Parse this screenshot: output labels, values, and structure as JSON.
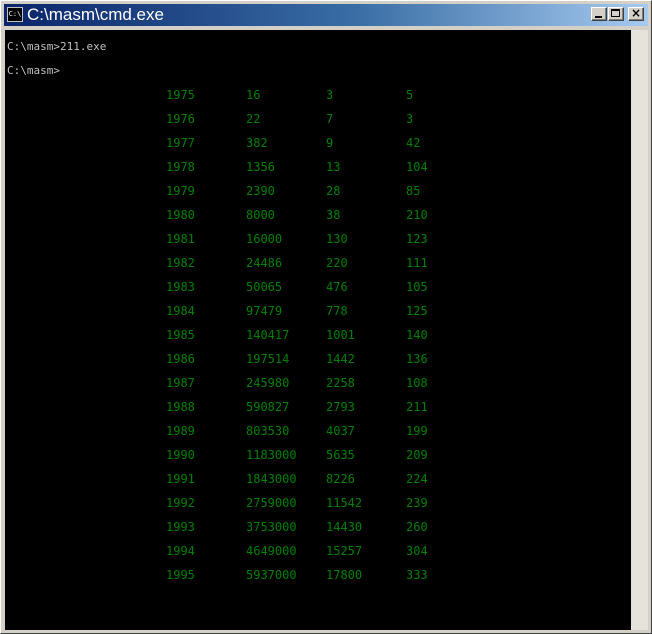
{
  "window": {
    "title": "C:\\masm\\cmd.exe",
    "icon_text": "C:\\",
    "controls": {
      "minimize": "minimize-icon",
      "maximize": "maximize-icon",
      "close": "close-icon",
      "close_glyph": "×"
    }
  },
  "console": {
    "lines": [
      "C:\\masm>211.exe",
      "C:\\masm>"
    ],
    "text_color": "#c0c0c0",
    "output_color": "#008000",
    "rows": [
      [
        "1975",
        "16",
        "3",
        "5"
      ],
      [
        "1976",
        "22",
        "7",
        "3"
      ],
      [
        "1977",
        "382",
        "9",
        "42"
      ],
      [
        "1978",
        "1356",
        "13",
        "104"
      ],
      [
        "1979",
        "2390",
        "28",
        "85"
      ],
      [
        "1980",
        "8000",
        "38",
        "210"
      ],
      [
        "1981",
        "16000",
        "130",
        "123"
      ],
      [
        "1982",
        "24486",
        "220",
        "111"
      ],
      [
        "1983",
        "50065",
        "476",
        "105"
      ],
      [
        "1984",
        "97479",
        "778",
        "125"
      ],
      [
        "1985",
        "140417",
        "1001",
        "140"
      ],
      [
        "1986",
        "197514",
        "1442",
        "136"
      ],
      [
        "1987",
        "245980",
        "2258",
        "108"
      ],
      [
        "1988",
        "590827",
        "2793",
        "211"
      ],
      [
        "1989",
        "803530",
        "4037",
        "199"
      ],
      [
        "1990",
        "1183000",
        "5635",
        "209"
      ],
      [
        "1991",
        "1843000",
        "8226",
        "224"
      ],
      [
        "1992",
        "2759000",
        "11542",
        "239"
      ],
      [
        "1993",
        "3753000",
        "14430",
        "260"
      ],
      [
        "1994",
        "4649000",
        "15257",
        "304"
      ],
      [
        "1995",
        "5937000",
        "17800",
        "333"
      ]
    ]
  }
}
